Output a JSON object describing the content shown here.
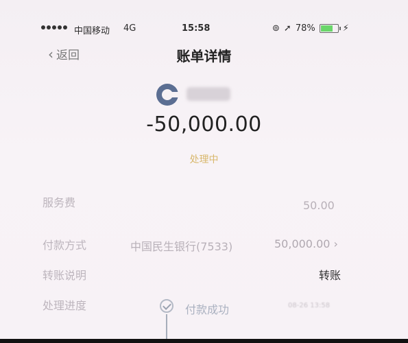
{
  "status_bar": {
    "carrier": "中国移动",
    "network": "4G",
    "time": "15:58",
    "location_icon": "location-arrow-icon",
    "battery": "78%",
    "battery_level": 0.78
  },
  "nav": {
    "back_label": "返回",
    "title": "账单详情"
  },
  "bank": {
    "logo_icon": "bank-logo-icon"
  },
  "amount": "-50,000.00",
  "status": "处理中",
  "details": {
    "fee_label": "服务费",
    "fee_value": "50.00",
    "payment_label": "付款方式",
    "payment_bank": "中国民生银行(7533)",
    "payment_amount": "50,000.00",
    "note_label": "转账说明",
    "note_value": "转账",
    "progress_label": "处理进度",
    "step1_label": "付款成功",
    "step1_time": "08-26 13:58"
  },
  "colors": {
    "status_accent": "#d9b86e",
    "bank_logo": "#5b6e92",
    "battery_fill": "#6ad66a"
  }
}
